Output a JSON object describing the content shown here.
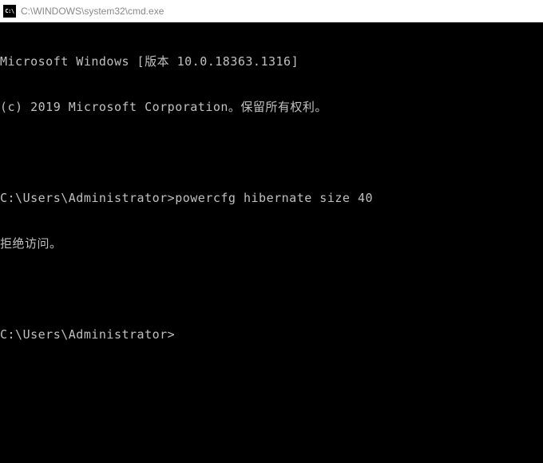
{
  "titlebar": {
    "icon_label": "C:\\",
    "title": "C:\\WINDOWS\\system32\\cmd.exe"
  },
  "terminal": {
    "lines": {
      "header1": "Microsoft Windows [版本 10.0.18363.1316]",
      "header2": "(c) 2019 Microsoft Corporation。保留所有权利。",
      "prompt1": "C:\\Users\\Administrator>powercfg hibernate size 40",
      "result1": "拒绝访问。",
      "prompt2": "C:\\Users\\Administrator>"
    }
  }
}
